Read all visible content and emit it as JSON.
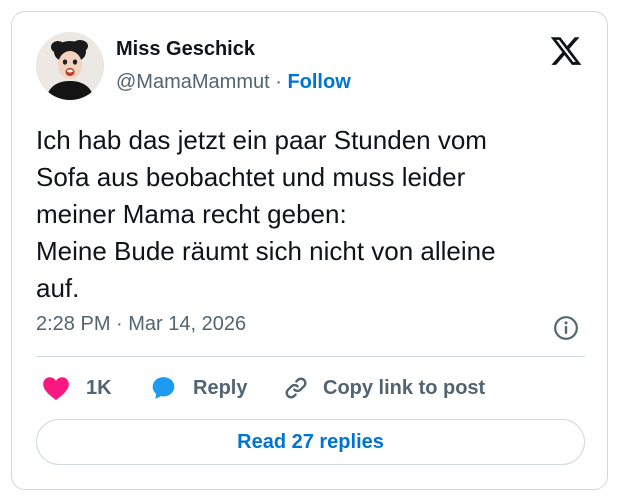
{
  "author": {
    "display_name": "Miss Geschick",
    "handle": "@MamaMammut",
    "separator": " · ",
    "follow_label": "Follow"
  },
  "tweet": {
    "lines": [
      "Ich hab das jetzt ein paar Stunden vom",
      "Sofa aus beobachtet und muss leider",
      "meiner Mama recht geben:",
      "Meine Bude räumt sich nicht von alleine",
      "auf."
    ],
    "time": "2:28 PM",
    "date_separator": " · ",
    "date": "Mar 14, 2026"
  },
  "actions": {
    "like_count": "1K",
    "reply_label": "Reply",
    "copy_link_label": "Copy link to post"
  },
  "read_replies_label": "Read 27 replies",
  "icons": {
    "logo": "x-logo-icon",
    "info": "info-icon",
    "like": "heart-icon",
    "reply": "speech-bubble-icon",
    "copy": "link-icon"
  },
  "colors": {
    "like": "#f91880",
    "reply": "#1d9bf0",
    "follow": "#0074d4",
    "muted": "#536471",
    "text": "#0f1419",
    "border": "#cfd9de"
  }
}
